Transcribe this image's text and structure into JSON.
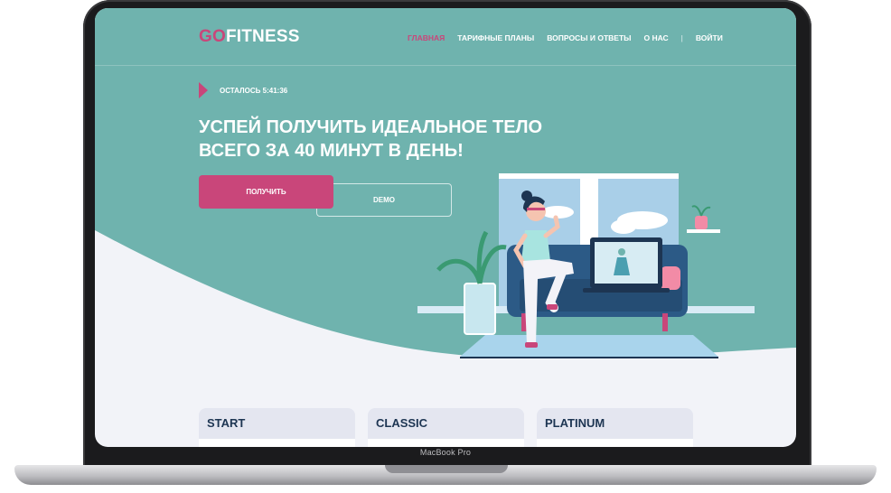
{
  "device": {
    "label": "MacBook Pro"
  },
  "logo": {
    "go": "GO",
    "fitness": "FITNESS"
  },
  "nav": {
    "items": [
      "ГЛАВНАЯ",
      "ТАРИФНЫЕ ПЛАНЫ",
      "ВОПРОСЫ И ОТВЕТЫ",
      "О НАС"
    ],
    "separator": "|",
    "login": "ВОЙТИ"
  },
  "hero": {
    "timer": "ОСТАЛОСЬ 5:41:36",
    "headline_line1": "УСПЕЙ ПОЛУЧИТЬ ИДЕАЛЬНОЕ ТЕЛО",
    "headline_line2": "ВСЕГО ЗА 40 МИНУТ В ДЕНЬ!",
    "primary_button": "ПОЛУЧИТЬ",
    "secondary_button": "DEMO"
  },
  "plans": [
    "START",
    "CLASSIC",
    "PLATINUM"
  ],
  "colors": {
    "teal": "#6fb3ae",
    "accent": "#c9467a",
    "navy": "#1d3552",
    "page": "#f2f3f8"
  }
}
